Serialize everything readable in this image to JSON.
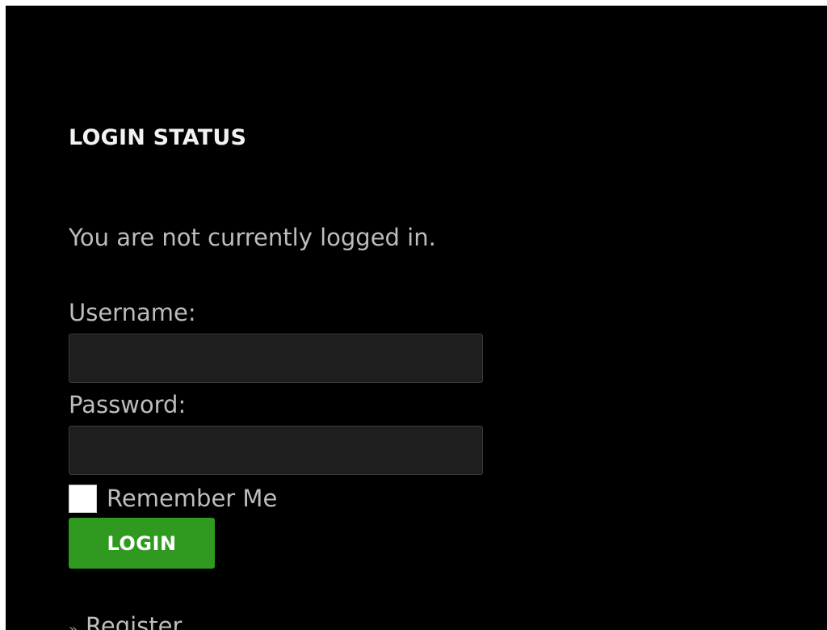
{
  "login_widget": {
    "title": "LOGIN STATUS",
    "status_message": "You are not currently logged in.",
    "username_label": "Username:",
    "username_value": "",
    "password_label": "Password:",
    "password_value": "",
    "remember_me_label": "Remember Me",
    "remember_me_checked": false,
    "login_button_label": "LOGIN",
    "links": [
      {
        "bullet": "»",
        "label": "Register"
      }
    ]
  },
  "colors": {
    "background": "#000000",
    "button_green": "#2f9a1f",
    "text": "#bdbdbd",
    "heading": "#f2f2f2",
    "input_background": "#1e1e1e"
  }
}
